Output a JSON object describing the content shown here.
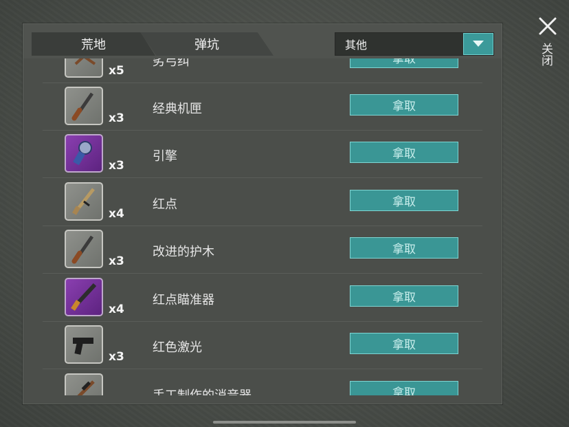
{
  "tabs": [
    {
      "label": "荒地"
    },
    {
      "label": "弹坑"
    }
  ],
  "filter": {
    "value": "其他"
  },
  "close": {
    "label": "关闭"
  },
  "items": [
    {
      "name": "劣弓纠",
      "qty": "x5",
      "button": "拿取",
      "icon": "crossbow-icon",
      "rarity": "gray"
    },
    {
      "name": "经典机匣",
      "qty": "x3",
      "button": "拿取",
      "icon": "shotgun-icon",
      "rarity": "gray"
    },
    {
      "name": "引擎",
      "qty": "x3",
      "button": "拿取",
      "icon": "engine-icon",
      "rarity": "purple"
    },
    {
      "name": "红点",
      "qty": "x4",
      "button": "拿取",
      "icon": "rifle-icon",
      "rarity": "gray"
    },
    {
      "name": "改进的护木",
      "qty": "x3",
      "button": "拿取",
      "icon": "shotgun-icon",
      "rarity": "gray"
    },
    {
      "name": "红点瞄准器",
      "qty": "x4",
      "button": "拿取",
      "icon": "pump-shotgun-icon",
      "rarity": "purple"
    },
    {
      "name": "红色激光",
      "qty": "x3",
      "button": "拿取",
      "icon": "pistol-icon",
      "rarity": "gray"
    },
    {
      "name": "手工制作的消音器",
      "qty": "",
      "button": "拿取",
      "icon": "scoped-rifle-icon",
      "rarity": "gray"
    }
  ],
  "colors": {
    "accent": "#3a9695",
    "purple_rarity": "#8a3fb0",
    "panel": "#4b4e4a"
  }
}
